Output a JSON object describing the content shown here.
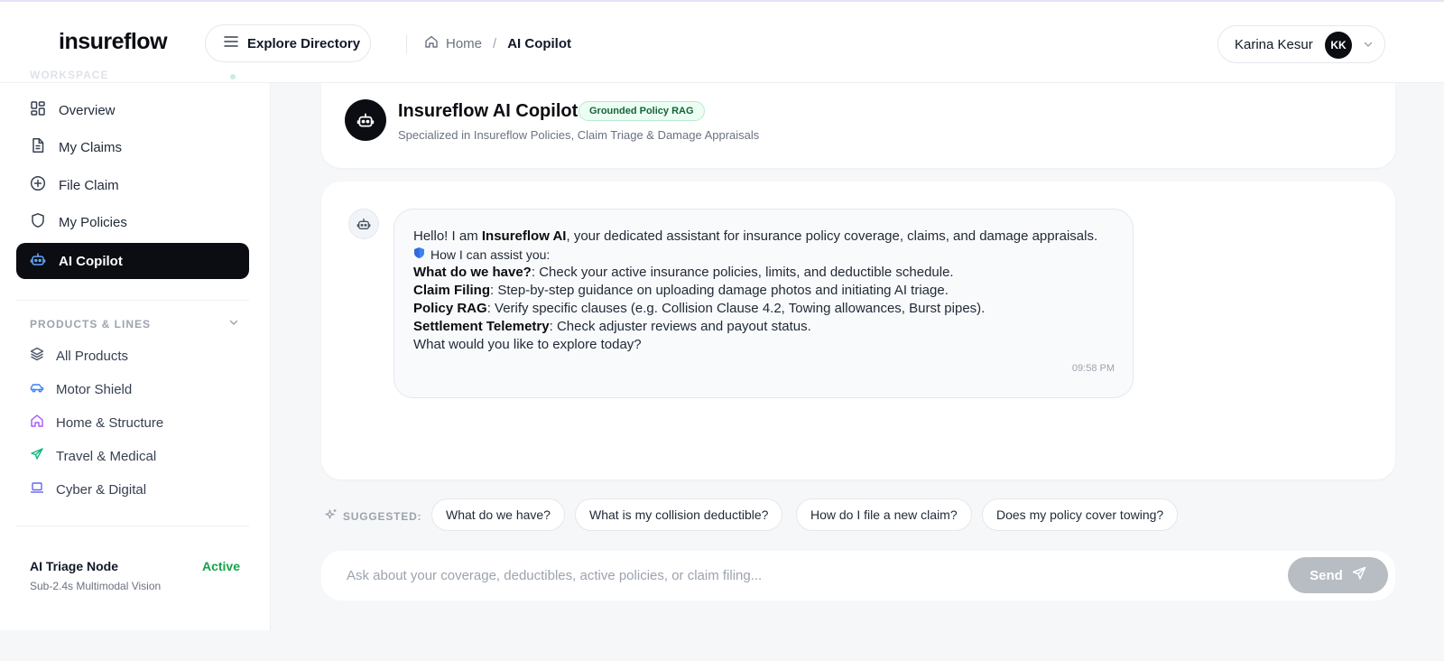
{
  "brand": {
    "logo": "insureflow"
  },
  "header": {
    "explore_label": "Explore Directory",
    "breadcrumb": {
      "home": "Home",
      "separator": "/",
      "current": "AI Copilot"
    },
    "user": {
      "name": "Karina Kesur",
      "initials": "KK"
    }
  },
  "sidebar": {
    "workspace_label": "WORKSPACE",
    "nav": [
      {
        "label": "Overview",
        "icon": "grid-icon"
      },
      {
        "label": "My Claims",
        "icon": "document-icon"
      },
      {
        "label": "File Claim",
        "icon": "plus-circle-icon"
      },
      {
        "label": "My Policies",
        "icon": "shield-icon"
      },
      {
        "label": "AI Copilot",
        "icon": "robot-icon",
        "active": true
      }
    ],
    "products_heading": "PRODUCTS & LINES",
    "products": [
      {
        "label": "All Products",
        "icon": "layers-icon",
        "color": "#4b5563"
      },
      {
        "label": "Motor Shield",
        "icon": "car-icon",
        "color": "#3b82f6"
      },
      {
        "label": "Home & Structure",
        "icon": "house-icon",
        "color": "#a855f7"
      },
      {
        "label": "Travel & Medical",
        "icon": "plane-icon",
        "color": "#10b981"
      },
      {
        "label": "Cyber & Digital",
        "icon": "laptop-icon",
        "color": "#6366f1"
      }
    ],
    "status": {
      "title": "AI Triage Node",
      "value": "Active",
      "subtitle": "Sub-2.4s Multimodal Vision"
    }
  },
  "copilot": {
    "title": "Insureflow AI Copilot",
    "badge": "Grounded Policy RAG",
    "subtitle": "Specialized in Insureflow Policies, Claim Triage & Damage Appraisals"
  },
  "message": {
    "intro_prefix": "Hello! I am ",
    "intro_name": "Insureflow AI",
    "intro_suffix": ", your dedicated assistant for insurance policy coverage, claims, and damage appraisals.",
    "assist_line": "How I can assist you:",
    "items": [
      {
        "title": "What do we have?",
        "text": ": Check your active insurance policies, limits, and deductible schedule."
      },
      {
        "title": "Claim Filing",
        "text": ": Step-by-step guidance on uploading damage photos and initiating AI triage."
      },
      {
        "title": "Policy RAG",
        "text": ": Verify specific clauses (e.g. Collision Clause 4.2, Towing allowances, Burst pipes)."
      },
      {
        "title": "Settlement Telemetry",
        "text": ": Check adjuster reviews and payout status."
      }
    ],
    "closing": "What would you like to explore today?",
    "time": "09:58 PM"
  },
  "suggestions": {
    "label": "SUGGESTED:",
    "chips": [
      "What do we have?",
      "What is my collision deductible?",
      "How do I file a new claim?",
      "Does my policy cover towing?"
    ]
  },
  "composer": {
    "placeholder": "Ask about your coverage, deductibles, active policies, or claim filing...",
    "value": "",
    "send_label": "Send"
  },
  "colors": {
    "accent": "#0b0d12",
    "active_status": "#16a34a",
    "send_disabled": "#b8bcc3",
    "badge_bg": "#ecfdf3"
  }
}
